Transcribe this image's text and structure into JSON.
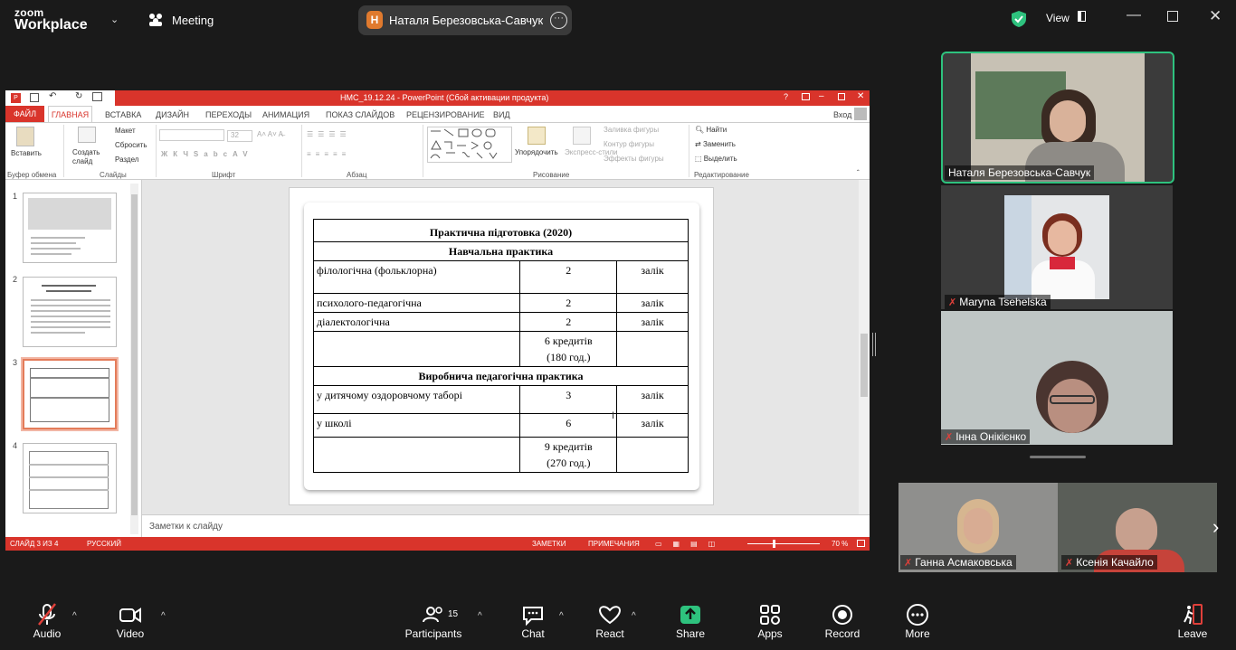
{
  "zoom": {
    "logo_top": "zoom",
    "logo_bottom": "Workplace",
    "meeting_label": "Meeting",
    "tab_avatar": "H",
    "tab_title": "Наталя Березовська-Савчук's sc",
    "view_label": "View"
  },
  "ppt": {
    "title": "НМС_19.12.24 - PowerPoint (Сбой активации продукта)",
    "signin": "Вход",
    "tabs": [
      "ФАЙЛ",
      "ГЛАВНАЯ",
      "ВСТАВКА",
      "ДИЗАЙН",
      "ПЕРЕХОДЫ",
      "АНИМАЦИЯ",
      "ПОКАЗ СЛАЙДОВ",
      "РЕЦЕНЗИРОВАНИЕ",
      "ВИД"
    ],
    "ribbon": {
      "paste": "Вставить",
      "clipboard_group": "Буфер обмена",
      "create_slide": "Создать слайд",
      "layout": "Макет",
      "reset": "Сбросить",
      "section": "Раздел",
      "slides_group": "Слайды",
      "font_size": "32",
      "font_group": "Шрифт",
      "paragraph_group": "Абзац",
      "arrange": "Упорядочить",
      "express_styles": "Экспресс-стили",
      "shape_fill": "Заливка фигуры",
      "shape_outline": "Контур фигуры",
      "shape_effects": "Эффекты фигуры",
      "drawing_group": "Рисование",
      "find": "Найти",
      "replace": "Заменить",
      "select": "Выделить",
      "editing_group": "Редактирование"
    },
    "slide_numbers": [
      "1",
      "2",
      "3",
      "4"
    ],
    "notes_placeholder": "Заметки к слайду",
    "status": {
      "slide_info": "СЛАЙД 3 ИЗ 4",
      "language": "РУССКИЙ",
      "notes": "ЗАМЕТКИ",
      "comments": "ПРИМЕЧАНИЯ",
      "zoom": "70 %"
    }
  },
  "slide_table": {
    "title": "Практична підготовка (2020)",
    "section1": "Навчальна практика",
    "rows1": [
      {
        "name": "філологічна (фольклорна)",
        "credits": "2",
        "form": "залік"
      },
      {
        "name": "психолого-педагогічна",
        "credits": "2",
        "form": "залік"
      },
      {
        "name": "діалектологічна",
        "credits": "2",
        "form": "залік"
      }
    ],
    "total1_a": "6 кредитів",
    "total1_b": "(180 год.)",
    "section2": "Виробнича педагогічна практика",
    "rows2": [
      {
        "name": "у дитячому оздоровчому таборі",
        "credits": "3",
        "form": "залік"
      },
      {
        "name": "у школі",
        "credits": "6",
        "form": "залік"
      }
    ],
    "total2_a": "9 кредитів",
    "total2_b": "(270 год.)"
  },
  "participants": [
    {
      "name": "Наталя Березовська-Савчук",
      "muted": false
    },
    {
      "name": "Maryna Tsehelska",
      "muted": true
    },
    {
      "name": "Інна Онікієнко",
      "muted": true
    },
    {
      "name": "Ганна Асмаковська",
      "muted": true
    },
    {
      "name": "Ксенія Качайло",
      "muted": true
    }
  ],
  "toolbar": {
    "audio": "Audio",
    "video": "Video",
    "participants": "Participants",
    "participants_count": "15",
    "chat": "Chat",
    "react": "React",
    "share": "Share",
    "apps": "Apps",
    "record": "Record",
    "more": "More",
    "leave": "Leave"
  },
  "colors": {
    "ppt_accent": "#d9342b",
    "active_speaker": "#2ec27e",
    "share_green": "#2ec27e",
    "muted_red": "#e0403a"
  }
}
